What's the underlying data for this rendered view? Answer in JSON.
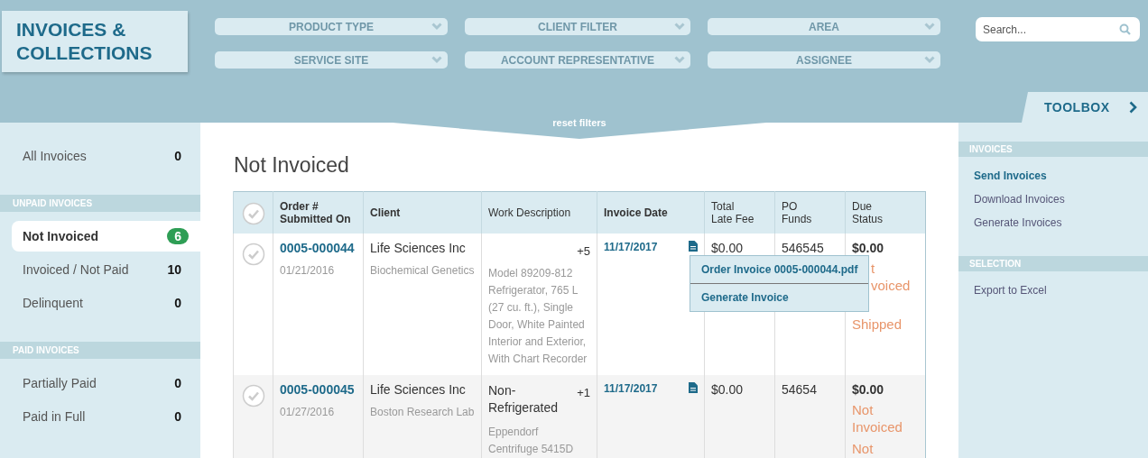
{
  "header": {
    "title": "INVOICES & COLLECTIONS",
    "filters": [
      {
        "label": "PRODUCT TYPE"
      },
      {
        "label": "CLIENT FILTER"
      },
      {
        "label": "AREA"
      },
      {
        "label": "SERVICE SITE"
      },
      {
        "label": "ACCOUNT REPRESENTATIVE"
      },
      {
        "label": "ASSIGNEE"
      }
    ],
    "search": {
      "placeholder": "Search..."
    },
    "toolbox": "TOOLBOX",
    "reset": "reset filters"
  },
  "sidebar": {
    "sections": [
      {
        "items": [
          {
            "label": "All Invoices",
            "count": "0",
            "selected": false
          }
        ]
      },
      {
        "heading": "UNPAID INVOICES",
        "items": [
          {
            "label": "Not Invoiced",
            "count": "6",
            "selected": true
          },
          {
            "label": "Invoiced / Not Paid",
            "count": "10",
            "selected": false
          },
          {
            "label": "Delinquent",
            "count": "0",
            "selected": false
          }
        ]
      },
      {
        "heading": "PAID INVOICES",
        "items": [
          {
            "label": "Partially Paid",
            "count": "0",
            "selected": false
          },
          {
            "label": "Paid in Full",
            "count": "0",
            "selected": false
          }
        ]
      }
    ]
  },
  "main": {
    "title": "Not Invoiced",
    "table": {
      "select_all": {
        "checked": false
      },
      "columns": [
        {
          "lines": [
            "Order #",
            "Submitted On"
          ],
          "bold": true
        },
        {
          "lines": [
            "Client"
          ],
          "bold": true
        },
        {
          "lines": [
            "Work Description"
          ],
          "bold": false
        },
        {
          "lines": [
            "Invoice Date"
          ],
          "bold": true
        },
        {
          "lines": [
            "Total",
            "Late Fee"
          ],
          "bold": false
        },
        {
          "lines": [
            "PO",
            "Funds"
          ],
          "bold": false
        },
        {
          "lines": [
            "Due",
            "Status"
          ],
          "bold": false
        }
      ],
      "rows": [
        {
          "checked": false,
          "order": "0005-000044",
          "submitted": "01/21/2016",
          "client": "Life Sciences Inc",
          "site": "Biochemical Genetics",
          "more": "+5",
          "work": "Model 89209-812 Refrigerator, 765 L (27 cu. ft.), Single Door, White Painted Interior and Exterior, With Chart Recorder",
          "invoice_date": "11/17/2017",
          "late_fee": "$0.00",
          "po": "546545",
          "due": "$0.00",
          "statuses": [
            {
              "text": "t",
              "covered": true
            },
            {
              "text": "voiced",
              "covered": true
            },
            {
              "text": "Shipped",
              "covered": false
            }
          ],
          "menu": [
            "Order Invoice 0005-000044.pdf",
            "Generate Invoice"
          ]
        },
        {
          "checked": false,
          "order": "0005-000045",
          "submitted": "01/27/2016",
          "client": "Life Sciences Inc",
          "site": "Boston Research Lab",
          "category": "Non-Refrigerated",
          "more": "+1",
          "work": "Eppendorf Centrifuge 5415D",
          "invoice_date": "11/17/2017",
          "late_fee": "$0.00",
          "po": "54654",
          "due": "$0.00",
          "statuses": [
            {
              "text": "Not Invoiced",
              "covered": false
            },
            {
              "text": "Not",
              "covered": false
            }
          ]
        }
      ]
    }
  },
  "toolbox": {
    "sections": [
      {
        "heading": "INVOICES",
        "items": [
          {
            "label": "Send Invoices",
            "selected": true
          },
          {
            "label": "Download Invoices",
            "selected": false
          },
          {
            "label": "Generate Invoices",
            "selected": false
          }
        ]
      },
      {
        "heading": "SELECTION",
        "items": [
          {
            "label": "Export to Excel",
            "selected": false
          }
        ]
      }
    ]
  }
}
